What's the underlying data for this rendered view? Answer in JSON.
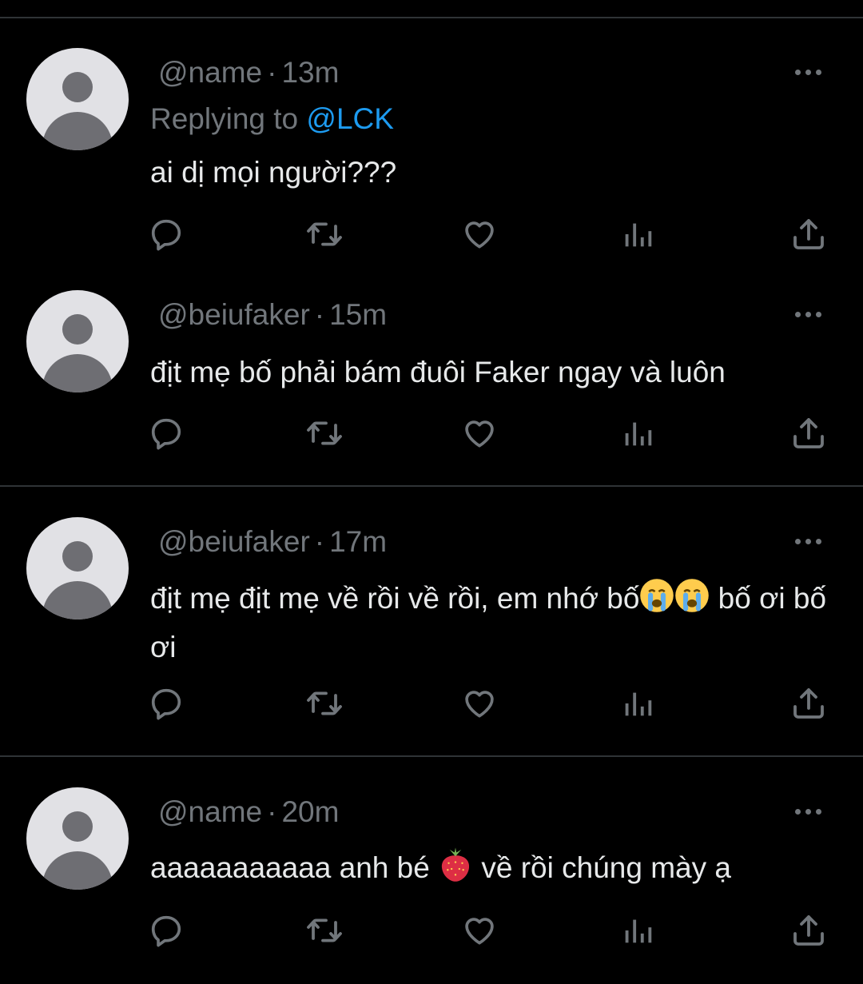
{
  "tweets": [
    {
      "handle": "@name",
      "time": "13m",
      "replying_label": "Replying to",
      "replying_handle": "@LCK",
      "text": "ai dị mọi người???"
    },
    {
      "handle": "@beiufaker",
      "time": "15m",
      "text": "địt mẹ bố phải bám đuôi Faker ngay và luôn"
    },
    {
      "handle": "@beiufaker",
      "time": "17m",
      "text_before_emoji": "địt mẹ địt mẹ về rồi về rồi, em nhớ bố",
      "text_after_emoji": " bố ơi bố ơi",
      "emoji": "loudly-crying-face x2"
    },
    {
      "handle": "@name",
      "time": "20m",
      "text_before_emoji": "aaaaaaaaaaa anh bé ",
      "text_after_emoji": " về rồi chúng mày ạ",
      "emoji": "strawberry"
    }
  ],
  "separator": "·",
  "icons": {
    "reply": "reply-icon",
    "retweet": "retweet-icon",
    "like": "heart-icon",
    "views": "views-icon",
    "share": "share-icon",
    "more": "more-icon",
    "avatar": "default-avatar-icon"
  },
  "colors": {
    "background": "#000000",
    "text": "#e7e9ea",
    "muted": "#71767b",
    "link": "#1d9bf0",
    "divider": "#2f3336"
  }
}
